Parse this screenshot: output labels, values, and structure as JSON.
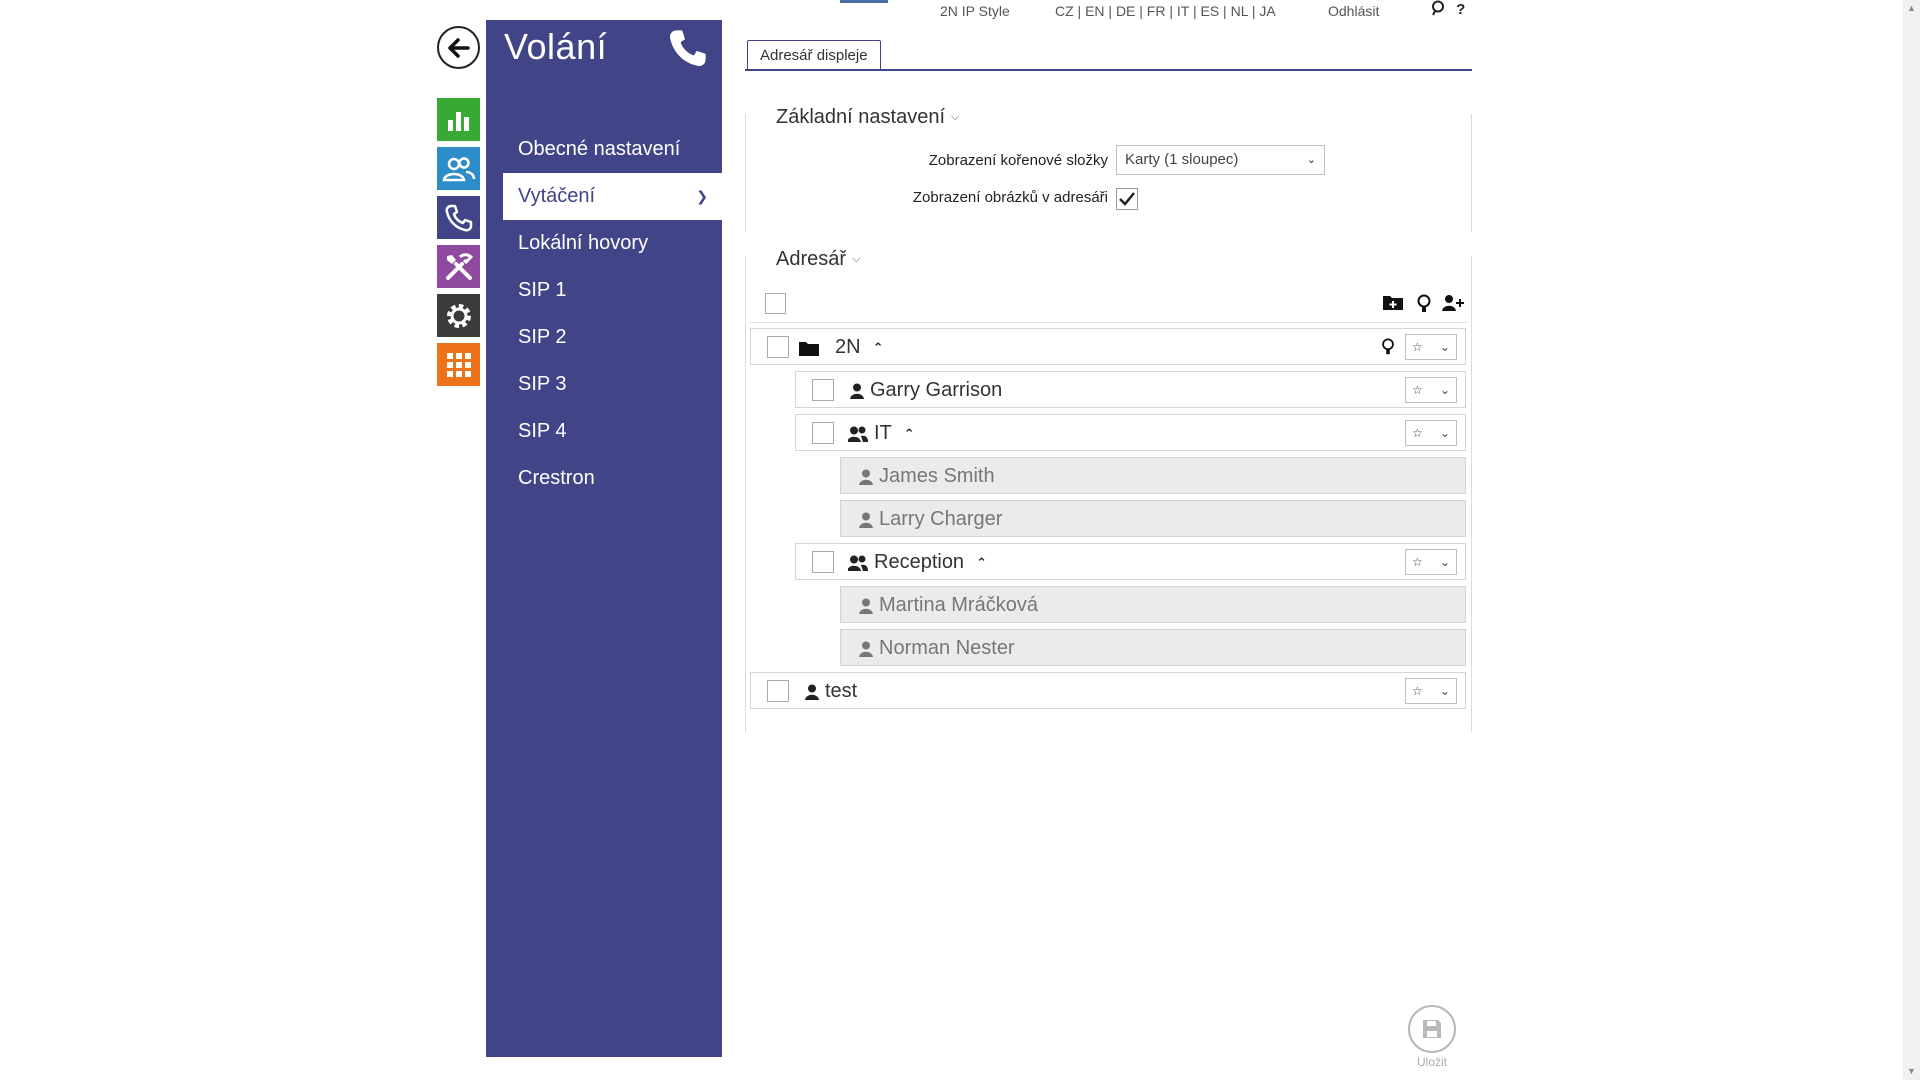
{
  "topbar": {
    "style_link": "2N IP Style",
    "languages": "CZ | EN | DE | FR | IT | ES | NL | JA",
    "logout": "Odhlásit",
    "help": "?"
  },
  "app_icons": [
    {
      "name": "status",
      "color": "#39a935",
      "icon": "bar-chart-icon"
    },
    {
      "name": "directory",
      "color": "#2d8dc9",
      "icon": "users-icon"
    },
    {
      "name": "calling",
      "color": "#414487",
      "icon": "phone-icon"
    },
    {
      "name": "hardware",
      "color": "#8f4a9f",
      "icon": "tools-icon"
    },
    {
      "name": "system",
      "color": "#3b3b3b",
      "icon": "gear-icon"
    },
    {
      "name": "services",
      "color": "#ee7219",
      "icon": "grid-icon"
    }
  ],
  "nav": {
    "title": "Volání",
    "items": [
      {
        "label": "Obecné nastavení"
      },
      {
        "label": "Vytáčení",
        "active": true
      },
      {
        "label": "Lokální hovory"
      },
      {
        "label": "SIP 1"
      },
      {
        "label": "SIP 2"
      },
      {
        "label": "SIP 3"
      },
      {
        "label": "SIP 4"
      },
      {
        "label": "Crestron"
      }
    ]
  },
  "tabs": [
    {
      "label": "Adresář displeje",
      "active": true
    }
  ],
  "basic": {
    "title": "Základní nastavení",
    "root_view_label": "Zobrazení kořenové složky",
    "root_view_value": "Karty (1 sloupec)",
    "show_images_label": "Zobrazení obrázků v adresáři",
    "show_images_checked": true
  },
  "directory": {
    "title": "Adresář",
    "rows": [
      {
        "label": "2N",
        "type": "folder"
      },
      {
        "label": "Garry Garrison",
        "type": "user"
      },
      {
        "label": "IT",
        "type": "group"
      },
      {
        "label": "James Smith",
        "type": "member"
      },
      {
        "label": "Larry Charger",
        "type": "member"
      },
      {
        "label": "Reception",
        "type": "group"
      },
      {
        "label": "Martina Mráčková",
        "type": "member"
      },
      {
        "label": "Norman Nester",
        "type": "member"
      },
      {
        "label": "test",
        "type": "user"
      }
    ]
  },
  "save": {
    "label": "Uložit"
  },
  "colors": {
    "accent": "#414487"
  }
}
